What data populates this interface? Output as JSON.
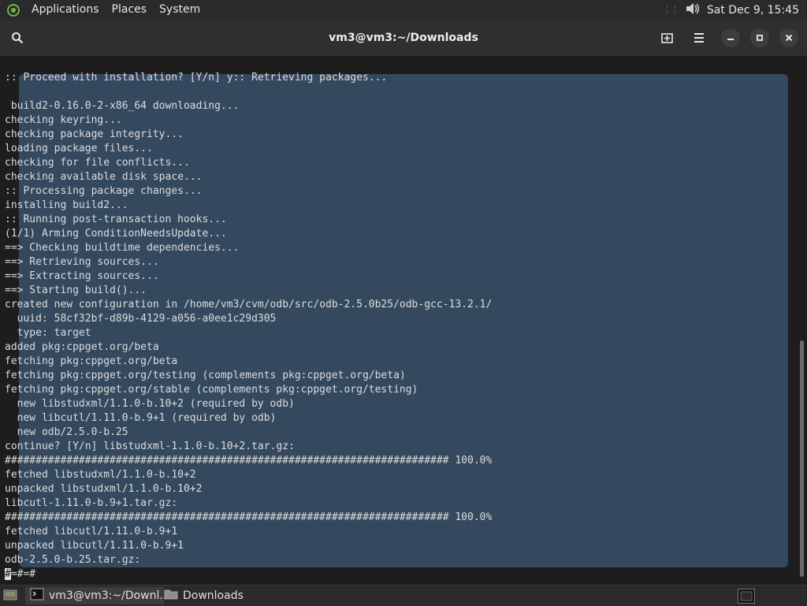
{
  "top_panel": {
    "menu": [
      "Applications",
      "Places",
      "System"
    ],
    "clock": "Sat Dec  9, 15:45"
  },
  "window": {
    "title": "vm3@vm3:~/Downloads"
  },
  "terminal": {
    "lines": [
      ":: Proceed with installation? [Y/n] y:: Retrieving packages...",
      "",
      " build2-0.16.0-2-x86_64 downloading...",
      "checking keyring...",
      "checking package integrity...",
      "loading package files...",
      "checking for file conflicts...",
      "checking available disk space...",
      ":: Processing package changes...",
      "installing build2...",
      ":: Running post-transaction hooks...",
      "(1/1) Arming ConditionNeedsUpdate...",
      "==> Checking buildtime dependencies...",
      "==> Retrieving sources...",
      "==> Extracting sources...",
      "==> Starting build()...",
      "created new configuration in /home/vm3/cvm/odb/src/odb-2.5.0b25/odb-gcc-13.2.1/",
      "  uuid: 58cf32bf-d89b-4129-a056-a0ee1c29d305",
      "  type: target",
      "added pkg:cppget.org/beta",
      "fetching pkg:cppget.org/beta",
      "fetching pkg:cppget.org/testing (complements pkg:cppget.org/beta)",
      "fetching pkg:cppget.org/stable (complements pkg:cppget.org/testing)",
      "  new libstudxml/1.1.0-b.10+2 (required by odb)",
      "  new libcutl/1.11.0-b.9+1 (required by odb)",
      "  new odb/2.5.0-b.25",
      "continue? [Y/n] libstudxml-1.1.0-b.10+2.tar.gz:",
      "######################################################################## 100.0%",
      "fetched libstudxml/1.1.0-b.10+2",
      "unpacked libstudxml/1.1.0-b.10+2",
      "libcutl-1.11.0-b.9+1.tar.gz:",
      "######################################################################## 100.0%",
      "fetched libcutl/1.11.0-b.9+1",
      "unpacked libcutl/1.11.0-b.9+1",
      "odb-2.5.0-b.25.tar.gz:"
    ],
    "cursor_char": "#",
    "prompt_rest": "=#=#"
  },
  "taskbar": {
    "tasks": [
      {
        "label": "vm3@vm3:~/Downl...",
        "icon": "terminal-icon"
      },
      {
        "label": "Downloads",
        "icon": "folder-icon"
      }
    ]
  },
  "colors": {
    "selection": "#34495e",
    "terminal_bg": "#1d1d1d",
    "panel_bg": "#2a2a2a"
  }
}
